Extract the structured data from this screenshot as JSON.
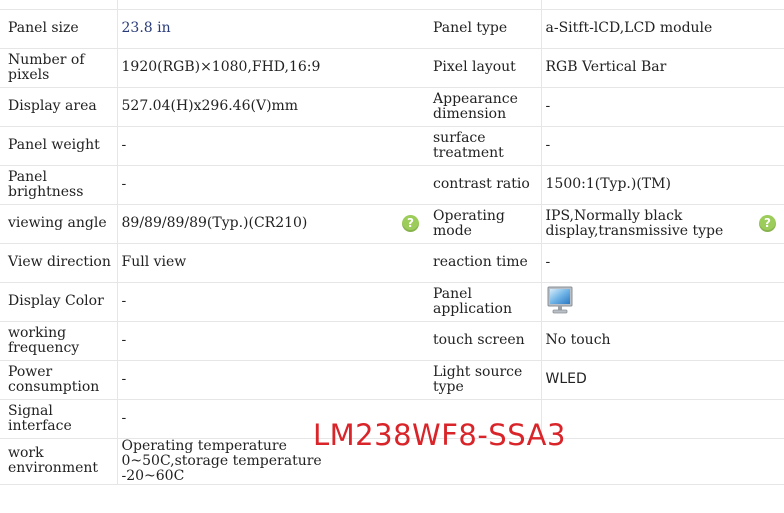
{
  "rows": [
    {
      "l1": "Panel size",
      "v1": "23.8 in",
      "l2": "Panel type",
      "v2": "a-Sitft-lCD,LCD module"
    },
    {
      "l1": "Number of pixels",
      "v1": "1920(RGB)×1080,FHD,16:9",
      "l2": "Pixel layout",
      "v2": "RGB Vertical Bar"
    },
    {
      "l1": "Display area",
      "v1": "527.04(H)x296.46(V)mm",
      "l2": "Appearance dimension",
      "v2": "-"
    },
    {
      "l1": "Panel weight",
      "v1": "-",
      "l2": "surface treatment",
      "v2": "-"
    },
    {
      "l1": "Panel brightness",
      "v1": "-",
      "l2": "contrast ratio",
      "v2": "1500:1(Typ.)(TM)"
    },
    {
      "l1": "viewing angle",
      "v1": "89/89/89/89(Typ.)(CR210)",
      "l2": "Operating mode",
      "v2": "IPS,Normally black display,transmissive type"
    },
    {
      "l1": "View direction",
      "v1": "Full view",
      "l2": "reaction time",
      "v2": "-"
    },
    {
      "l1": "Display Color",
      "v1": "-",
      "l2": "Panel application",
      "v2": ""
    },
    {
      "l1": "working frequency",
      "v1": "-",
      "l2": "touch screen",
      "v2": "No touch"
    },
    {
      "l1": "Power consumption",
      "v1": "-",
      "l2": "Light source type",
      "v2": "WLED"
    },
    {
      "l1": "Signal interface",
      "v1": "-",
      "l2": "",
      "v2": ""
    },
    {
      "l1": "work environment",
      "v1": "Operating temperature 0~50C,storage temperature -20~60C",
      "l2": "",
      "v2": ""
    }
  ],
  "help_glyph": "?",
  "panel_application_icon": "monitor-icon",
  "watermark": "LM238WF8-SSA3",
  "colors": {
    "value_blue": "#2a3b7a",
    "watermark_red": "#d9252a",
    "help_green": "#9ccc5a"
  }
}
